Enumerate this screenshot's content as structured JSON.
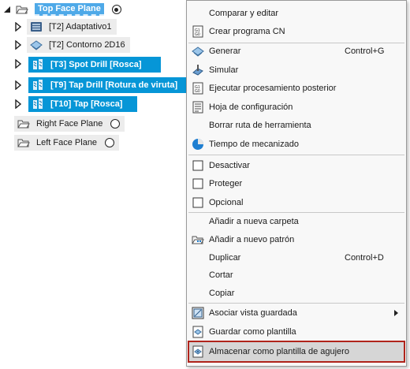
{
  "tree": {
    "top_plane": {
      "label": "Top Face Plane",
      "active": true
    },
    "operations": [
      {
        "label": "[T2] Adaptativo1",
        "icon": "adaptive-icon",
        "selected": false
      },
      {
        "label": "[T2] Contorno 2D16",
        "icon": "contour-icon",
        "selected": false
      },
      {
        "label": "[T3] Spot Drill [Rosca]",
        "icon": "drill-icon",
        "selected": true
      },
      {
        "label": "[T9] Tap Drill [Rotura de viruta]",
        "icon": "drill-icon",
        "selected": true
      },
      {
        "label": "[T10] Tap [Rosca]",
        "icon": "drill-icon",
        "selected": true
      }
    ],
    "planes": [
      {
        "label": "Right Face Plane",
        "active": false
      },
      {
        "label": "Left Face Plane",
        "active": false
      }
    ]
  },
  "menu": {
    "items": [
      {
        "label": "Comparar y editar",
        "shortcut": "",
        "icon": ""
      },
      {
        "label": "Crear programa CN",
        "shortcut": "",
        "icon": "nc-program-icon"
      },
      {
        "label": "Generar",
        "shortcut": "Control+G",
        "icon": "generate-icon"
      },
      {
        "label": "Simular",
        "shortcut": "",
        "icon": "simulate-icon"
      },
      {
        "label": "Ejecutar procesamiento posterior",
        "shortcut": "",
        "icon": "post-process-icon"
      },
      {
        "label": "Hoja de configuración",
        "shortcut": "",
        "icon": "setup-sheet-icon"
      },
      {
        "label": "Borrar ruta de herramienta",
        "shortcut": "",
        "icon": ""
      },
      {
        "label": "Tiempo de mecanizado",
        "shortcut": "",
        "icon": "machining-time-icon"
      },
      {
        "label": "Desactivar",
        "shortcut": "",
        "icon": "checkbox-icon"
      },
      {
        "label": "Proteger",
        "shortcut": "",
        "icon": "checkbox-icon"
      },
      {
        "label": "Opcional",
        "shortcut": "",
        "icon": "checkbox-icon"
      },
      {
        "label": "Añadir a nueva carpeta",
        "shortcut": "",
        "icon": ""
      },
      {
        "label": "Añadir a nuevo patrón",
        "shortcut": "",
        "icon": "pattern-folder-icon"
      },
      {
        "label": "Duplicar",
        "shortcut": "Control+D",
        "icon": ""
      },
      {
        "label": "Cortar",
        "shortcut": "",
        "icon": ""
      },
      {
        "label": "Copiar",
        "shortcut": "",
        "icon": ""
      },
      {
        "label": "Asociar vista guardada",
        "shortcut": "",
        "icon": "saved-view-icon",
        "submenu": true
      },
      {
        "label": "Guardar como plantilla",
        "shortcut": "",
        "icon": "template-icon"
      },
      {
        "label": "Almacenar como plantilla de agujero",
        "shortcut": "",
        "icon": "hole-template-icon",
        "highlighted": true
      }
    ]
  },
  "colors": {
    "selection": "#0696d7",
    "highlight_border": "#b0241b"
  }
}
